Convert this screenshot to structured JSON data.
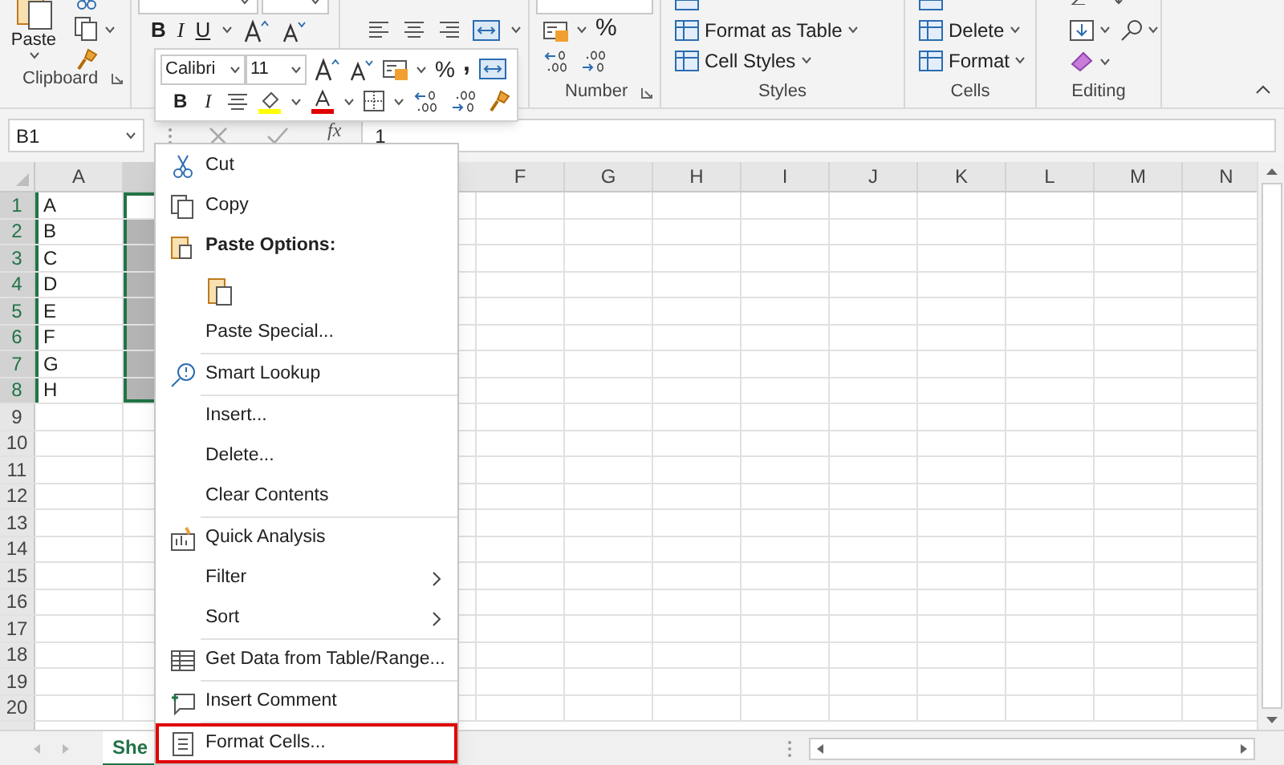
{
  "ribbon": {
    "clipboard": {
      "paste": "Paste",
      "label": "Clipboard"
    },
    "font": {
      "bold": "B",
      "italic": "I",
      "underline": "U"
    },
    "number": {
      "percent": "%",
      "label": "Number"
    },
    "styles": {
      "items": [
        "Format as Table",
        "Cell Styles"
      ],
      "label": "Styles"
    },
    "cells": {
      "items": [
        "Delete",
        "Format"
      ],
      "label": "Cells"
    },
    "editing": {
      "label": "Editing"
    }
  },
  "mini_toolbar": {
    "font": "Calibri",
    "size": "11",
    "percent": "%",
    "comma": ",",
    "bold": "B",
    "italic": "I"
  },
  "formula_bar": {
    "name_box": "B1",
    "function": "fx",
    "value": "1"
  },
  "sheet": {
    "columns": [
      "A",
      "F",
      "G",
      "H",
      "I",
      "J",
      "K",
      "L",
      "M",
      "N"
    ],
    "rows": [
      {
        "label": "1",
        "selected": true,
        "active": true,
        "column_a": "A"
      },
      {
        "label": "2",
        "selected": true,
        "active": false,
        "column_a": "B"
      },
      {
        "label": "3",
        "selected": true,
        "active": false,
        "column_a": "C"
      },
      {
        "label": "4",
        "selected": true,
        "active": false,
        "column_a": "D"
      },
      {
        "label": "5",
        "selected": true,
        "active": false,
        "column_a": "E"
      },
      {
        "label": "6",
        "selected": true,
        "active": false,
        "column_a": "F"
      },
      {
        "label": "7",
        "selected": true,
        "active": false,
        "column_a": "G"
      },
      {
        "label": "8",
        "selected": true,
        "active": false,
        "column_a": "H"
      },
      {
        "label": "9",
        "selected": false,
        "active": false
      },
      {
        "label": "10",
        "selected": false,
        "active": false
      },
      {
        "label": "11",
        "selected": false,
        "active": false
      },
      {
        "label": "12",
        "selected": false,
        "active": false
      },
      {
        "label": "13",
        "selected": false,
        "active": false
      },
      {
        "label": "14",
        "selected": false,
        "active": false
      },
      {
        "label": "15",
        "selected": false,
        "active": false
      },
      {
        "label": "16",
        "selected": false,
        "active": false
      },
      {
        "label": "17",
        "selected": false,
        "active": false
      },
      {
        "label": "18",
        "selected": false,
        "active": false
      },
      {
        "label": "19",
        "selected": false,
        "active": false
      },
      {
        "label": "20",
        "selected": false,
        "active": false
      }
    ]
  },
  "sheet_tabs": [
    {
      "label": "She",
      "selected": true
    }
  ],
  "context_menu": [
    {
      "kind": "item",
      "label": "Cut",
      "submenu": false,
      "highlighted": false
    },
    {
      "kind": "item",
      "label": "Copy",
      "submenu": false,
      "highlighted": false
    },
    {
      "kind": "header",
      "label": "Paste Options:"
    },
    {
      "kind": "paste"
    },
    {
      "kind": "item",
      "label": "Paste Special...",
      "submenu": false,
      "highlighted": false
    },
    {
      "kind": "separator"
    },
    {
      "kind": "item",
      "label": "Smart Lookup",
      "submenu": false,
      "highlighted": false
    },
    {
      "kind": "separator"
    },
    {
      "kind": "item",
      "label": "Insert...",
      "submenu": false,
      "highlighted": false
    },
    {
      "kind": "item",
      "label": "Delete...",
      "submenu": false,
      "highlighted": false
    },
    {
      "kind": "item",
      "label": "Clear Contents",
      "submenu": false,
      "highlighted": false
    },
    {
      "kind": "separator"
    },
    {
      "kind": "item",
      "label": "Quick Analysis",
      "submenu": false,
      "highlighted": false
    },
    {
      "kind": "item",
      "label": "Filter",
      "submenu": true,
      "highlighted": false
    },
    {
      "kind": "item",
      "label": "Sort",
      "submenu": true,
      "highlighted": false
    },
    {
      "kind": "separator"
    },
    {
      "kind": "item",
      "label": "Get Data from Table/Range...",
      "submenu": false,
      "highlighted": false
    },
    {
      "kind": "separator"
    },
    {
      "kind": "item",
      "label": "Insert Comment",
      "submenu": false,
      "highlighted": false
    },
    {
      "kind": "separator"
    },
    {
      "kind": "item",
      "label": "Format Cells...",
      "submenu": false,
      "highlighted": true
    }
  ]
}
